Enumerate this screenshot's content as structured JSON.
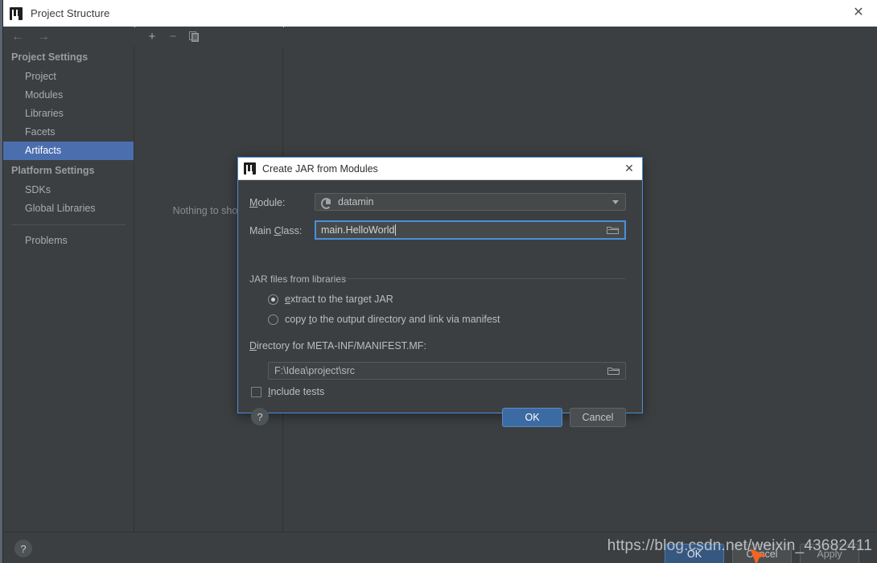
{
  "window": {
    "title": "Project Structure",
    "close_label": "✕",
    "logo_name": "intellij-idea-logo"
  },
  "nav": {
    "back": "←",
    "forward": "→"
  },
  "sidebar": {
    "groups": [
      {
        "label": "Project Settings",
        "items": [
          {
            "label": "Project",
            "selected": false
          },
          {
            "label": "Modules",
            "selected": false
          },
          {
            "label": "Libraries",
            "selected": false
          },
          {
            "label": "Facets",
            "selected": false
          },
          {
            "label": "Artifacts",
            "selected": true
          }
        ]
      },
      {
        "label": "Platform Settings",
        "items": [
          {
            "label": "SDKs",
            "selected": false
          },
          {
            "label": "Global Libraries",
            "selected": false
          }
        ]
      }
    ],
    "problems": "Problems"
  },
  "toolbar": {
    "add": "+",
    "remove": "−",
    "copy": "copy-icon"
  },
  "panel": {
    "empty_text": "Nothing to show"
  },
  "bottom_bar": {
    "help": "?",
    "ok": "OK",
    "cancel": "Cancel",
    "apply": "Apply"
  },
  "dialog": {
    "title": "Create JAR from Modules",
    "close_label": "✕",
    "module": {
      "label_prefix": "M",
      "label_rest": "odule:",
      "value": "datamin",
      "icon": "module-icon"
    },
    "main_class": {
      "label_prefix": "Main ",
      "label_mnemonic": "C",
      "label_rest": "lass:",
      "value": "main.HelloWorld",
      "browse_icon": "folder-icon"
    },
    "jar_group": {
      "label": "JAR files from libraries",
      "options": [
        {
          "prefix": "",
          "mnemonic": "e",
          "rest": "xtract to the target JAR",
          "selected": true
        },
        {
          "prefix": "copy ",
          "mnemonic": "t",
          "rest": "o the output directory and link via manifest",
          "selected": false
        }
      ]
    },
    "manifest": {
      "label_prefix": "D",
      "label_rest": "irectory for META-INF/MANIFEST.MF:",
      "path": "F:\\Idea\\project\\src",
      "browse_icon": "folder-icon"
    },
    "include_tests": {
      "label_prefix": "I",
      "label_rest": "nclude tests",
      "checked": false
    },
    "help": "?",
    "ok": "OK",
    "cancel": "Cancel"
  },
  "watermark": {
    "text": "https://blog.csdn.net/weixin_43682411"
  },
  "colors": {
    "accent_selected": "#4b6eaf",
    "dialog_border": "#4a90d9",
    "primary_button": "#3c6ba3",
    "panel_bg": "#3c3f41",
    "titlebar_bg": "#ffffff"
  }
}
